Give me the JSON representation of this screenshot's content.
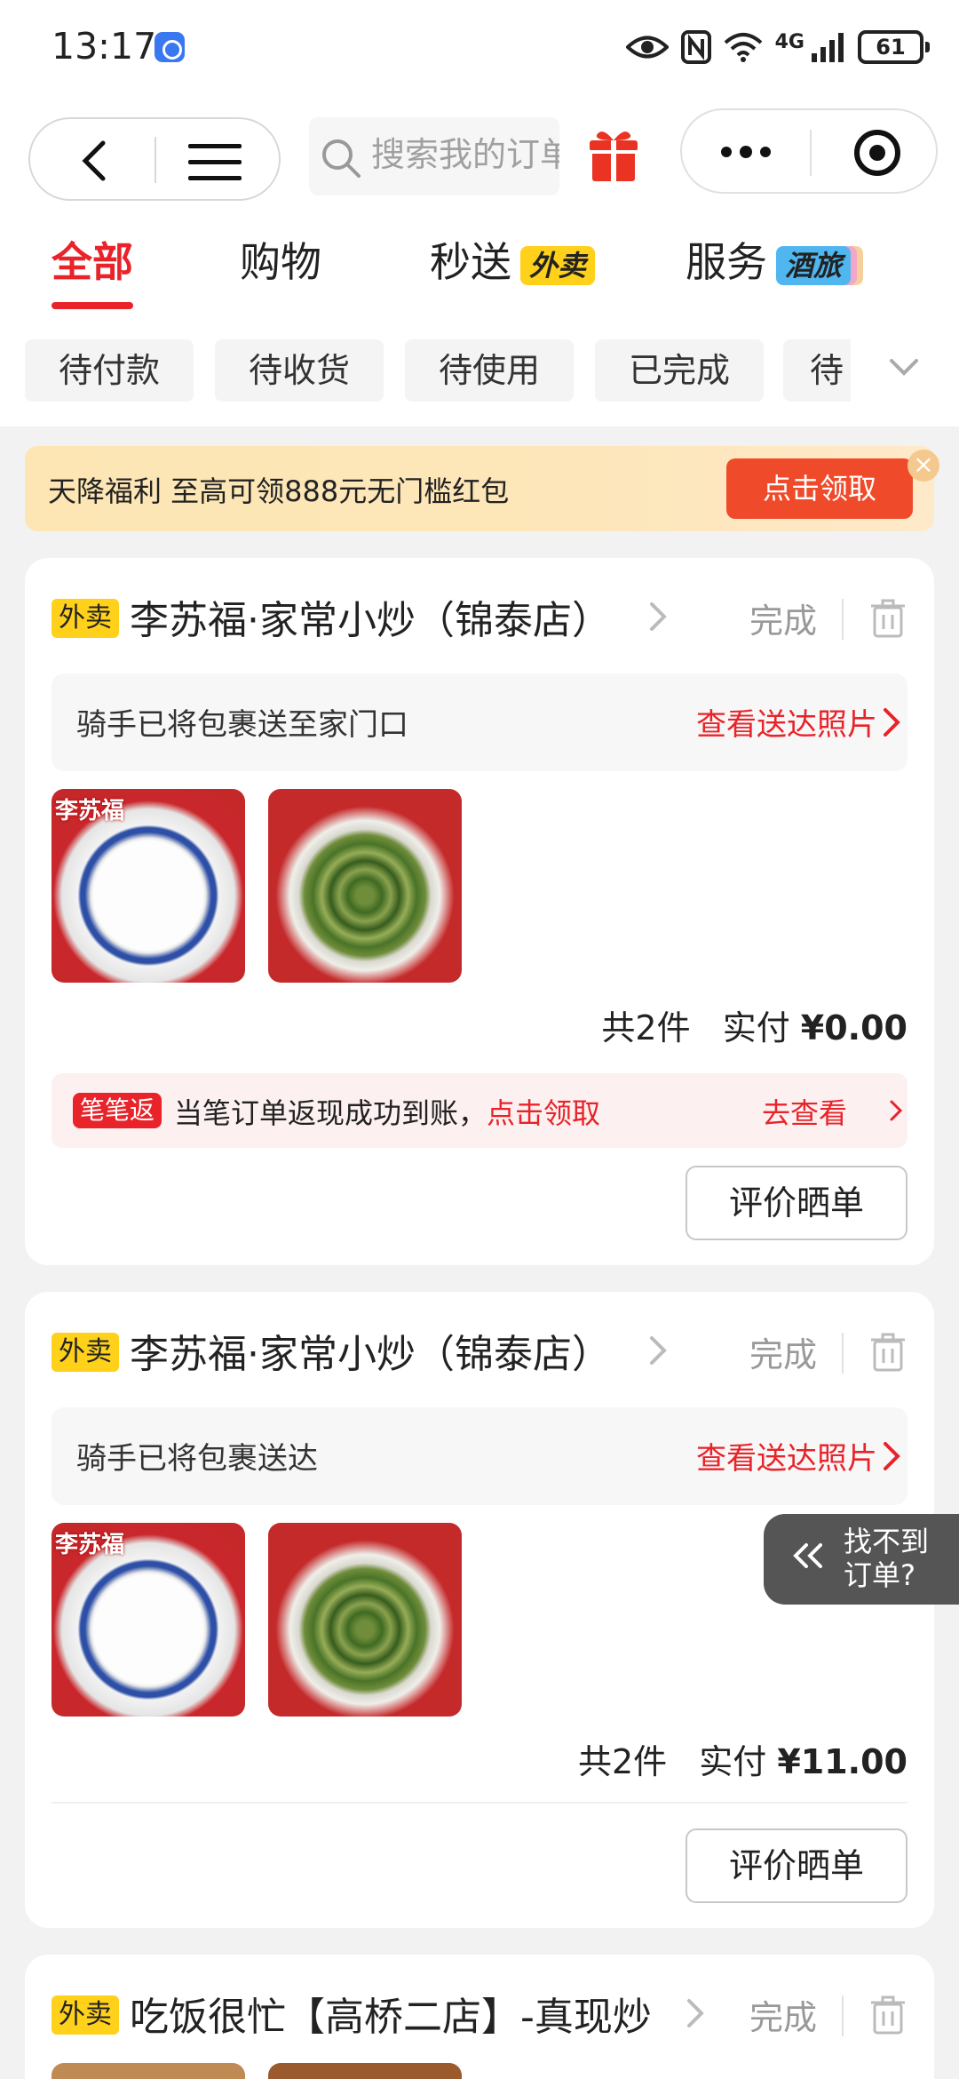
{
  "status_bar": {
    "time": "13:17",
    "network": "4G",
    "battery": "61"
  },
  "nav": {
    "search_placeholder": "搜索我的订单"
  },
  "tabs": [
    {
      "label": "全部",
      "active": true
    },
    {
      "label": "购物"
    },
    {
      "label": "秒送",
      "badge": "外卖"
    },
    {
      "label": "服务",
      "badge": "酒旅"
    }
  ],
  "filters": [
    "待付款",
    "待收货",
    "待使用",
    "已完成",
    "待"
  ],
  "promo": {
    "text": "天降福利 至高可领888元无门槛红包",
    "button": "点击领取"
  },
  "orders": [
    {
      "tag": "外卖",
      "shop": "李苏福·家常小炒（锦泰店）",
      "status": "完成",
      "delivery_text": "骑手已将包裹送至家门口",
      "delivery_link": "查看送达照片",
      "thumb_logo": "李苏福",
      "count": "共2件",
      "paid_label": "实付",
      "paid_amount": "¥0.00",
      "cashback_tag": "笔笔返",
      "cashback_text": "当笔订单返现成功到账，",
      "cashback_link": "点击领取",
      "cashback_go": "去查看",
      "action": "评价晒单"
    },
    {
      "tag": "外卖",
      "shop": "李苏福·家常小炒（锦泰店）",
      "status": "完成",
      "delivery_text": "骑手已将包裹送达",
      "delivery_link": "查看送达照片",
      "thumb_logo": "李苏福",
      "count": "共2件",
      "paid_label": "实付",
      "paid_amount": "¥11.00",
      "action": "评价晒单"
    },
    {
      "tag": "外卖",
      "shop": "吃饭很忙【高桥二店】-真现炒",
      "status": "完成"
    }
  ],
  "floating": {
    "label": "找不到订单?"
  },
  "colors": {
    "accent": "#e8232a",
    "tag_yellow": "#ffd11a",
    "promo_btn": "#ef4b2b"
  }
}
